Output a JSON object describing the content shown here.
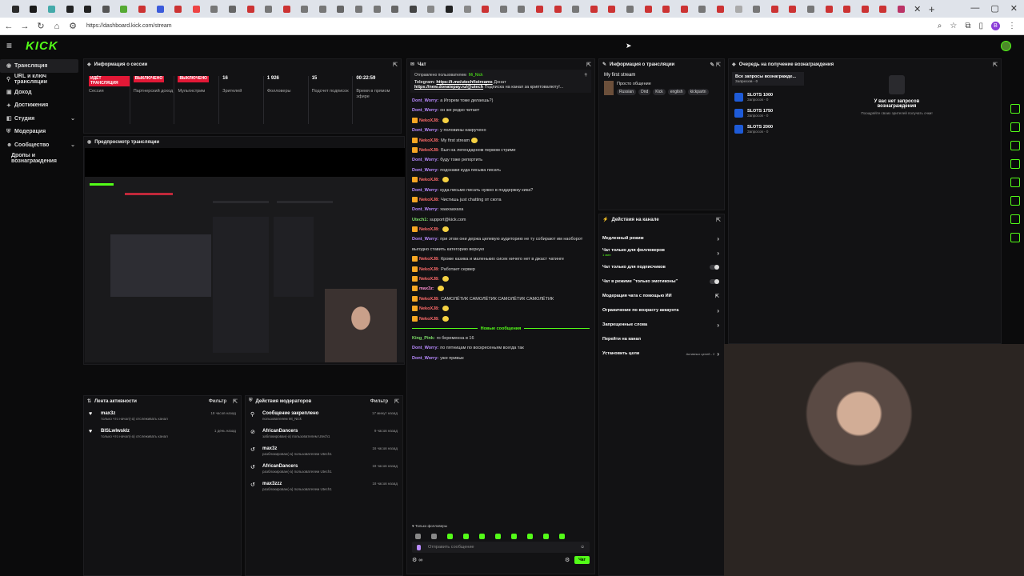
{
  "browser": {
    "tab_close": "✕",
    "tab_new": "+",
    "url": "https://dashboard.kick.com/stream",
    "win_min": "—",
    "win_max": "▢",
    "win_close": "✕",
    "profile_initial": "B",
    "favicon_colors": [
      "#2a2a2a",
      "#1a1a1a",
      "#4aa",
      "#222",
      "#222",
      "#555",
      "#5a3",
      "#c33",
      "#3b5bdb",
      "#c33",
      "#e44",
      "#777",
      "#666",
      "#c33",
      "#777",
      "#c33",
      "#777",
      "#777",
      "#666",
      "#777",
      "#777",
      "#666",
      "#444",
      "#888",
      "#222",
      "#888",
      "#c33",
      "#777",
      "#777",
      "#c33",
      "#c33",
      "#777",
      "#c33",
      "#c33",
      "#777",
      "#c33",
      "#c33",
      "#c33",
      "#777",
      "#c33",
      "#aaa",
      "#777",
      "#c33",
      "#c33",
      "#777",
      "#c33",
      "#c33",
      "#c33",
      "#c33",
      "#b36"
    ]
  },
  "brand": {
    "logo": "KICK",
    "accent": "#53fc18"
  },
  "sidebar": {
    "items": [
      {
        "label": "Трансляция",
        "active": true
      },
      {
        "label": "URL и ключ трансляции"
      },
      {
        "label": "Доход"
      },
      {
        "label": "Достижения"
      },
      {
        "label": "Студия",
        "chevron": true
      },
      {
        "label": "Модерация"
      },
      {
        "label": "Сообщество",
        "chevron": true
      },
      {
        "label": "Дропы и вознаграждения",
        "sub": true
      }
    ]
  },
  "session": {
    "title": "Информация о сессии",
    "stats": [
      {
        "badge": "ИДЁТ ТРАНСЛЯЦИЯ",
        "label": "Сессия"
      },
      {
        "badge": "ВЫКЛЮЧЕНО",
        "label": "Партнерский доход"
      },
      {
        "badge": "ВЫКЛЮЧЕНО",
        "label": "Мультистрим"
      },
      {
        "value": "16",
        "label": "Зрителей"
      },
      {
        "value": "1 926",
        "label": "Фолловеры"
      },
      {
        "value": "15",
        "label": "Подсчет подписок"
      },
      {
        "value": "00:22:59",
        "label": "Время в прямом эфире"
      }
    ]
  },
  "preview": {
    "title": "Предпросмотр трансляции"
  },
  "activity": {
    "title": "Лента активности",
    "filter": "Фильтр",
    "items": [
      {
        "name": "max3z",
        "desc": "только что начал(-а) отслеживать канал",
        "time": "18 часов назад"
      },
      {
        "name": "BlSLwlwsklz",
        "desc": "только что начал(-а) отслеживать канал",
        "time": "1 день назад"
      }
    ]
  },
  "modactions": {
    "title": "Действия модераторов",
    "filter": "Фильтр",
    "items": [
      {
        "name": "Сообщение закреплено",
        "desc": "пользователем Mi_Nick",
        "time": "17 минут назад"
      },
      {
        "name": "AfricanDancers",
        "desc": "заблокирован(-а) пользователем Utech1",
        "time": "9 часов назад"
      },
      {
        "name": "max3z",
        "desc": "разблокирован(-а) пользователем Utech1",
        "time": "16 часов назад"
      },
      {
        "name": "AfricanDancers",
        "desc": "разблокирован(-а) пользователем Utech1",
        "time": "18 часов назад"
      },
      {
        "name": "max3zzz",
        "desc": "разблокирован(-а) пользователем Utech1",
        "time": "18 часов назад"
      }
    ]
  },
  "chat": {
    "title": "Чат",
    "pinned": {
      "by": "Отправлено пользователем",
      "user": "Mi_Nick",
      "label": "Telegram:",
      "link1": "https://t.me/utechfistreams",
      "mid": "Донат",
      "link2": "https://new.donatepay.ru/@utech",
      "tail": "Подписка на канал за криптовалюту!..."
    },
    "messages": [
      {
        "user": "Dont_Worry:",
        "cls": "u-dw",
        "text": "а Игорем тоже делаешь?)"
      },
      {
        "user": "Dont_Worry:",
        "cls": "u-dw",
        "text": "он же редко читает"
      },
      {
        "user": "NekoXJ8:",
        "cls": "u-nx",
        "text": "",
        "emote": true
      },
      {
        "user": "Dont_Worry:",
        "cls": "u-dw",
        "text": "у половины накручено"
      },
      {
        "user": "NekoXJ8:",
        "cls": "u-nx",
        "text": "My first stream",
        "emote": true
      },
      {
        "user": "NekoXJ8:",
        "cls": "u-nx",
        "text": "Был на легендарном первом стриме"
      },
      {
        "user": "Dont_Worry:",
        "cls": "u-dw",
        "text": "буду тоже репортить"
      },
      {
        "user": "Dont_Worry:",
        "cls": "u-dw",
        "text": "подскажи куда письма писать"
      },
      {
        "user": "NekoXJ8:",
        "cls": "u-nx",
        "text": "",
        "emote": true
      },
      {
        "user": "Dont_Worry:",
        "cls": "u-dw",
        "text": "куда письмо писать нужно в поддержку кика?"
      },
      {
        "user": "NekoXJ8:",
        "cls": "u-nx",
        "text": "Чистишь just chatting от скота"
      },
      {
        "user": "Dont_Worry:",
        "cls": "u-dw",
        "text": "хаахаахаха"
      },
      {
        "user": "Utech1:",
        "cls": "u-kp",
        "text": "support@kick.com"
      },
      {
        "user": "NekoXJ8:",
        "cls": "u-nx",
        "text": "",
        "emote": true
      },
      {
        "user": "Dont_Worry:",
        "cls": "u-dw",
        "text": "при этом они держа целевую аудиторию не ту собирают им наоборот"
      },
      {
        "user": "",
        "cls": "u-dw",
        "text": "выгодно ставить категорию верную"
      },
      {
        "user": "NekoXJ8:",
        "cls": "u-nx",
        "text": "Кроме казика и маленьких сисек ничего нет в джаст чатинге"
      },
      {
        "user": "NekoXJ8:",
        "cls": "u-nx",
        "text": "Работает сервер"
      },
      {
        "user": "NekoXJ8:",
        "cls": "u-nx",
        "text": "",
        "emote": true
      },
      {
        "user": "max3z:",
        "cls": "u-m3",
        "text": "",
        "emote": true
      },
      {
        "user": "NekoXJ8:",
        "cls": "u-nx",
        "text": "САМОЛЁТИК   САМОЛЁТИК   САМОЛЁТИК   САМОЛЁТИК"
      },
      {
        "user": "NekoXJ8:",
        "cls": "u-nx",
        "text": "",
        "emote": true
      },
      {
        "user": "NekoXJ8:",
        "cls": "u-nx",
        "text": "",
        "emote": true
      }
    ],
    "new_label": "Новые сообщения",
    "new_messages": [
      {
        "user": "King_Pink:",
        "cls": "u-kp",
        "text": "го беременна в 16"
      },
      {
        "user": "Dont_Worry:",
        "cls": "u-dw",
        "text": "по пятницам по воскресеньям всегда так"
      },
      {
        "user": "Dont_Worry:",
        "cls": "u-dw",
        "text": "уже привык"
      }
    ],
    "followers_only": "Только фолловеры",
    "input_placeholder": "Отправить сообщение",
    "send": "Чат"
  },
  "stream_info": {
    "title": "Информация о трансляции",
    "stream_title": "My first stream",
    "category": "Просто общение",
    "tags": [
      "Russian",
      "Dnd",
      "Kick",
      "english",
      "kickpartn"
    ]
  },
  "channel_actions": {
    "title": "Действия на канале",
    "rows": [
      {
        "label": "Медленный режим",
        "kind": "arrow"
      },
      {
        "label": "Чат только для фолловеров",
        "kind": "arrow",
        "sub": "1 мин"
      },
      {
        "label": "Чат только для подписчиков",
        "kind": "toggle"
      },
      {
        "label": "Чат в режиме \"только эмотиконы\"",
        "kind": "toggle"
      },
      {
        "label": "Модерация чата с помощью ИИ",
        "kind": "ext"
      },
      {
        "label": "Ограничение по возрасту аккаунта",
        "kind": "arrow"
      },
      {
        "label": "Запрещенные слова",
        "kind": "arrow"
      },
      {
        "label": "Перейти на канал",
        "kind": "none"
      },
      {
        "label": "Установить цели",
        "kind": "arrow",
        "extra": "Активных целей - 2"
      }
    ]
  },
  "queue": {
    "title": "Очередь на получение вознаграждения",
    "all": "Все запросы вознагражде...",
    "all_sub": "Запросов - 0",
    "items": [
      {
        "name": "SLOTS 1000",
        "sub": "Запросов - 0"
      },
      {
        "name": "SLOTS 1750",
        "sub": "Запросов - 0"
      },
      {
        "name": "SLOTS 2000",
        "sub": "Запросов - 0"
      }
    ],
    "empty_title": "У вас нет запросов вознаграждения",
    "empty_sub": "Поощряйте своих зрителей получать очки!"
  }
}
